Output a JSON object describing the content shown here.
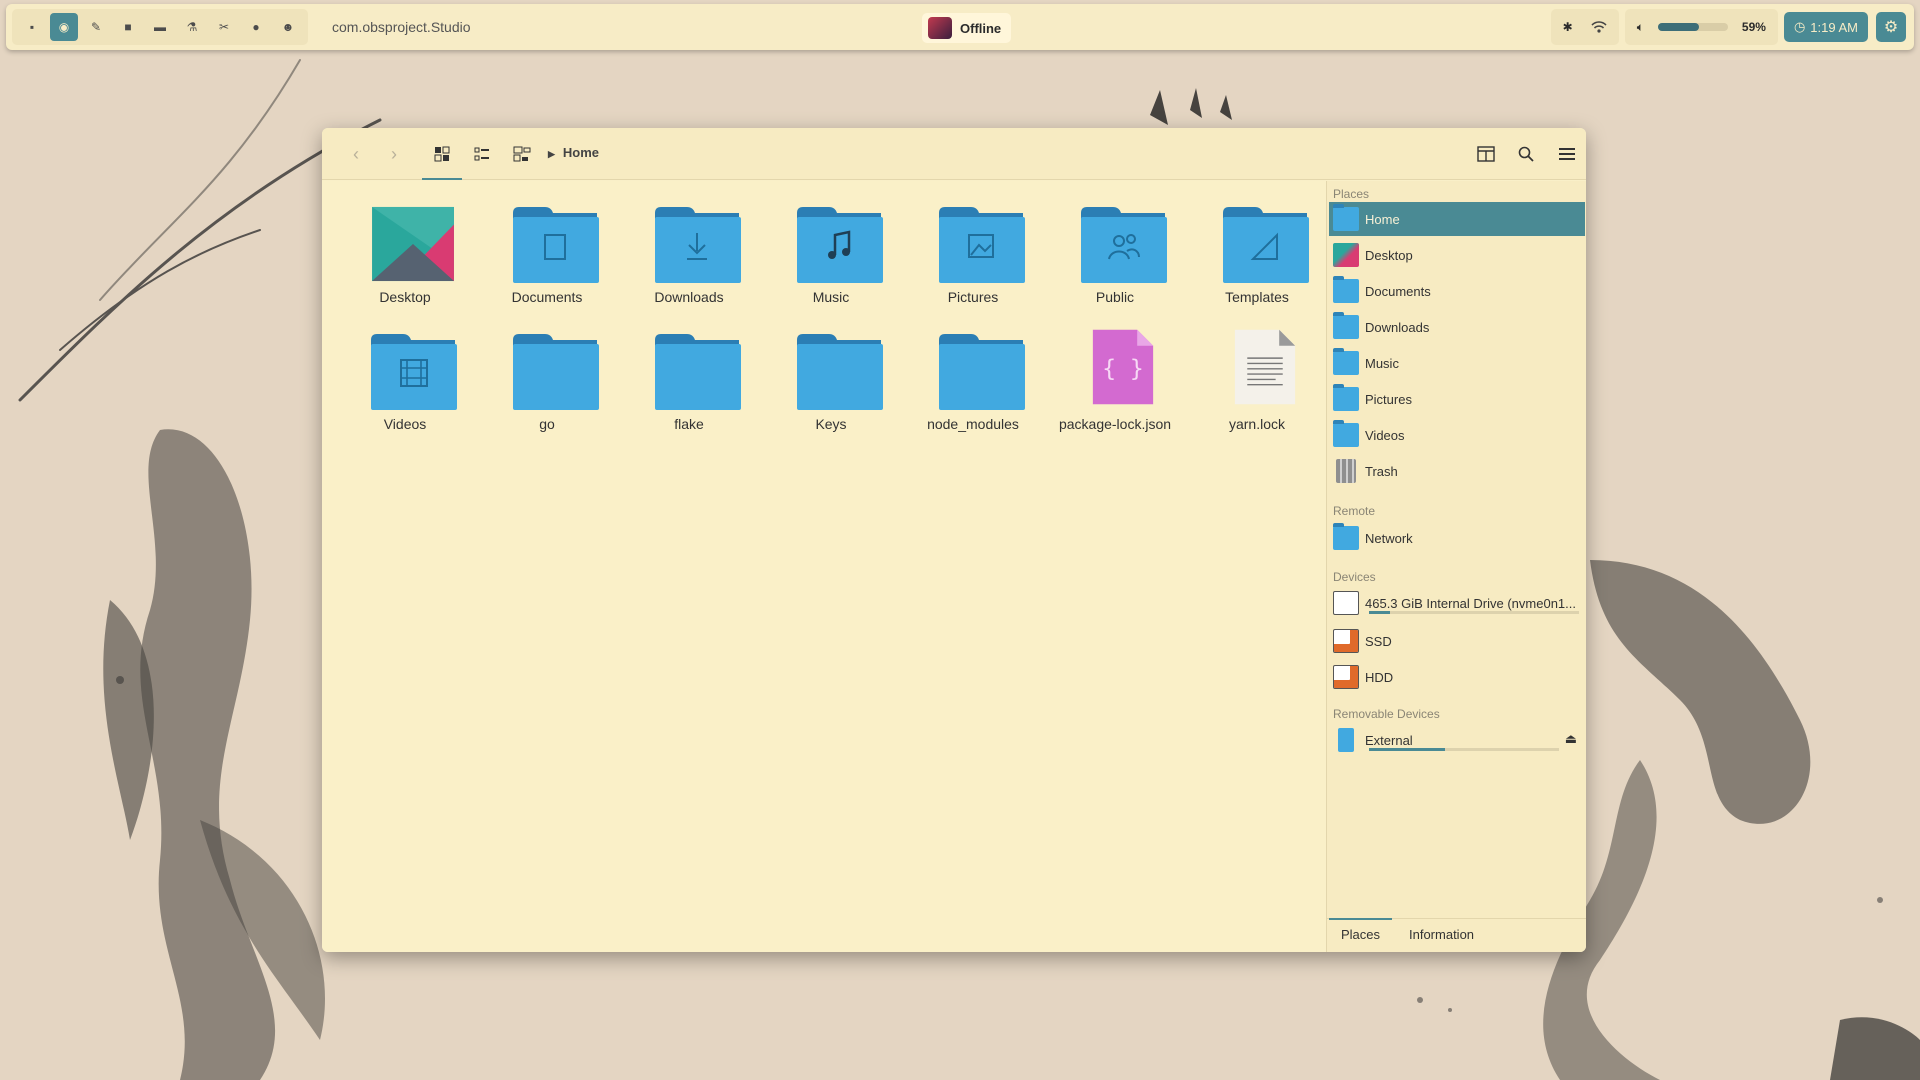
{
  "topbar": {
    "app_title": "com.obsproject.Studio",
    "status": "Offline",
    "volume_percent": "59%",
    "volume_level": 0.59,
    "time": "1:19 AM",
    "launcher_icons": [
      "terminal-icon",
      "firefox-icon",
      "pen-icon",
      "folder-icon",
      "chat-icon",
      "flask-icon",
      "tools-icon",
      "spotify-icon",
      "discord-icon"
    ]
  },
  "file_manager": {
    "breadcrumb": "Home",
    "items": [
      {
        "label": "Desktop",
        "kind": "desktop"
      },
      {
        "label": "Documents",
        "kind": "folder-documents"
      },
      {
        "label": "Downloads",
        "kind": "folder-downloads"
      },
      {
        "label": "Music",
        "kind": "folder-music"
      },
      {
        "label": "Pictures",
        "kind": "folder-pictures"
      },
      {
        "label": "Public",
        "kind": "folder-public"
      },
      {
        "label": "Templates",
        "kind": "folder-templates"
      },
      {
        "label": "Videos",
        "kind": "folder-videos"
      },
      {
        "label": "go",
        "kind": "folder"
      },
      {
        "label": "flake",
        "kind": "folder"
      },
      {
        "label": "Keys",
        "kind": "folder"
      },
      {
        "label": "node_modules",
        "kind": "folder"
      },
      {
        "label": "package-lock.json",
        "kind": "json-file"
      },
      {
        "label": "yarn.lock",
        "kind": "text-file"
      }
    ]
  },
  "sidebar": {
    "places_title": "Places",
    "places": [
      "Home",
      "Desktop",
      "Documents",
      "Downloads",
      "Music",
      "Pictures",
      "Videos",
      "Trash"
    ],
    "remote_title": "Remote",
    "remote": [
      "Network"
    ],
    "devices_title": "Devices",
    "devices": [
      {
        "label": "465.3 GiB Internal Drive (nvme0n1...",
        "usage": 0.1
      },
      {
        "label": "SSD"
      },
      {
        "label": "HDD"
      }
    ],
    "removable_title": "Removable Devices",
    "removable": [
      {
        "label": "External",
        "usage": 0.4
      }
    ],
    "tabs": [
      "Places",
      "Information"
    ]
  },
  "colors": {
    "accent": "#4a8a94",
    "folder": "#41a9e0",
    "panel": "#f7ebc2"
  }
}
